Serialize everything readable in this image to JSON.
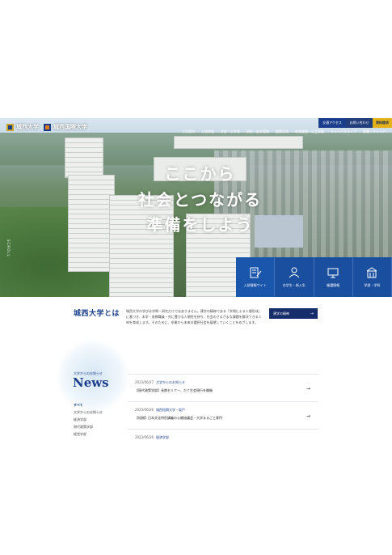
{
  "header": {
    "logos": [
      {
        "name": "城西大学"
      },
      {
        "name": "城西国際大学"
      }
    ],
    "utility": {
      "access": "交通アクセス",
      "contact": "お問い合わせ",
      "donate": "資料請求"
    },
    "nav": [
      "大学案内",
      "入試情報",
      "学部・大学院",
      "研究・産学連携",
      "国際交流",
      "地域連携・社会貢献",
      "キャンパスライフ",
      "就職・キャリア"
    ]
  },
  "hero": {
    "catch_lines": [
      "ここから",
      "社会とつながる",
      "準備をしよう"
    ],
    "scroll_label": "SCROLL"
  },
  "quick_links": [
    {
      "label": "入試情報サイト",
      "icon": "document-pen-icon"
    },
    {
      "label": "在学生・新入生",
      "icon": "student-icon"
    },
    {
      "label": "厳選情報",
      "icon": "monitor-icon"
    },
    {
      "label": "学部・学科",
      "icon": "building-icon"
    }
  ],
  "about": {
    "title": "城西大学とは",
    "text": "城西大学の学びは学問・研究だけではありません。建学の精神である「学問による人間形成」に基づき、本学・各教職員・共に豊かな人間性を持ち、社会のさまざまな課題を解決できる人材を育成します。そのために、卒業から未来の選択社会を展望していくことをめざします。",
    "button_label": "建学の精神"
  },
  "news": {
    "subtitle": "大学からのお知らせ",
    "title": "News",
    "categories": [
      "すべて",
      "大学からのお知らせ",
      "経済学部",
      "現代政策学部",
      "経営学部"
    ],
    "items": [
      {
        "date": "2023/06/27",
        "category": "大学からのお知らせ",
        "title": "【現代政策学部】長期セミナー、だて生会現行を開催"
      },
      {
        "date": "2023/06/26",
        "category": "城西短期大学・坂戸",
        "title": "【短期】日本文化特別講義の公開協議会・大学まるごと専門"
      },
      {
        "date": "2023/06/26",
        "category": "経済学部",
        "title": ""
      }
    ]
  },
  "colors": {
    "primary": "#1a3e8c",
    "accent": "#e3b21a",
    "quick_bg": "#1a4fa0"
  }
}
